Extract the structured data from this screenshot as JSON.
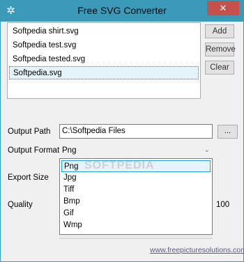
{
  "window": {
    "title": "Free SVG Converter",
    "close_glyph": "✕"
  },
  "files": [
    "Softpedia shirt.svg",
    "Softpedia test.svg",
    "Softpedia tested.svg",
    "Softpedia.svg"
  ],
  "buttons": {
    "add": "Add",
    "remove": "Remove",
    "clear": "Clear",
    "browse": "..."
  },
  "output": {
    "path_label": "Output Path",
    "path_value": "C:\\Softpedia Files",
    "format_label": "Output Format",
    "format_value": "Png",
    "export_size_label": "Export Size",
    "quality_label": "Quality",
    "quality_value": "100"
  },
  "format_options": [
    "Png",
    "Jpg",
    "Tiff",
    "Bmp",
    "Gif",
    "Wmp"
  ],
  "watermark": "SOFTPEDIA",
  "footer": {
    "link": "www.freepicturesolutions.com"
  },
  "colors": {
    "titlebar": "#3c9ab9",
    "close": "#c7504b",
    "selection": "#e5f3fb"
  }
}
